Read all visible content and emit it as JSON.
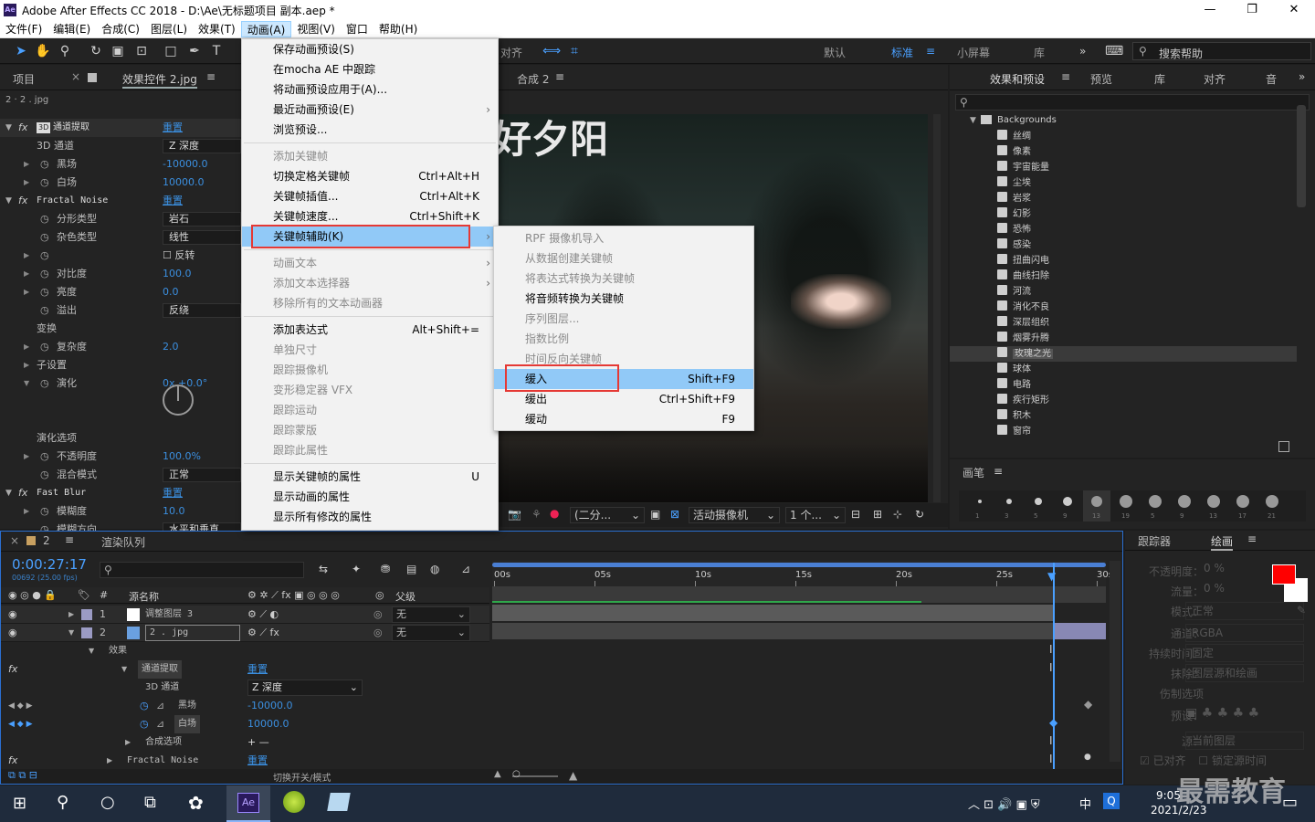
{
  "title": {
    "text": "Adobe After Effects CC 2018 - D:\\Ae\\无标题项目 副本.aep *",
    "logo": "Ae"
  },
  "menubar": [
    "文件(F)",
    "编辑(E)",
    "合成(C)",
    "图层(L)",
    "效果(T)",
    "动画(A)",
    "视图(V)",
    "窗口",
    "帮助(H)"
  ],
  "toolbar": {
    "workspaces": [
      "默认",
      "标准",
      "小屏幕",
      "库"
    ],
    "align_label": "对齐",
    "search_placeholder": "搜索帮助"
  },
  "left_panel": {
    "tabs": [
      "项目",
      "效果控件 2.jpg"
    ],
    "breadcrumb": "2 · 2 . jpg",
    "effects": [
      {
        "name": "通道提取",
        "badge": "3D",
        "reset": "重置"
      },
      {
        "name": "Fractal Noise",
        "reset": "重置"
      },
      {
        "name": "Fast Blur",
        "reset": "重置"
      }
    ],
    "props": [
      {
        "name": "3D 通道",
        "value": "Z 深度",
        "type": "box"
      },
      {
        "name": "黑场",
        "value": "-10000.0"
      },
      {
        "name": "白场",
        "value": "10000.0"
      },
      {
        "name": "分形类型",
        "value": "岩石",
        "type": "box"
      },
      {
        "name": "杂色类型",
        "value": "线性",
        "type": "box"
      },
      {
        "name": "",
        "value": "反转",
        "type": "check"
      },
      {
        "name": "对比度",
        "value": "100.0"
      },
      {
        "name": "亮度",
        "value": "0.0"
      },
      {
        "name": "溢出",
        "value": "反绕",
        "type": "box"
      },
      {
        "name": "变换",
        "value": ""
      },
      {
        "name": "复杂度",
        "value": "2.0"
      },
      {
        "name": "子设置",
        "value": ""
      },
      {
        "name": "演化",
        "value": "0x +0.0°"
      },
      {
        "name": "演化选项",
        "value": ""
      },
      {
        "name": "不透明度",
        "value": "100.0%"
      },
      {
        "name": "混合模式",
        "value": "正常",
        "type": "box"
      },
      {
        "name": "模糊度",
        "value": "10.0"
      },
      {
        "name": "模糊方向",
        "value": "水平和垂直",
        "type": "box"
      }
    ]
  },
  "anim_menu": {
    "items": [
      {
        "label": "保存动画预设(S)",
        "dis": false
      },
      {
        "label": "在mocha AE 中跟踪",
        "dis": false
      },
      {
        "label": "将动画预设应用于(A)...",
        "dis": false
      },
      {
        "label": "最近动画预设(E)",
        "dis": false,
        "arrow": true
      },
      {
        "label": "浏览预设...",
        "dis": false
      },
      {
        "sep": true
      },
      {
        "label": "添加关键帧",
        "dis": true
      },
      {
        "label": "切换定格关键帧",
        "sc": "Ctrl+Alt+H",
        "dis": false
      },
      {
        "label": "关键帧插值...",
        "sc": "Ctrl+Alt+K",
        "dis": false
      },
      {
        "label": "关键帧速度...",
        "sc": "Ctrl+Shift+K",
        "dis": false
      },
      {
        "label": "关键帧辅助(K)",
        "dis": false,
        "arrow": true,
        "hl": true
      },
      {
        "sep": true
      },
      {
        "label": "动画文本",
        "dis": true,
        "arrow": true
      },
      {
        "label": "添加文本选择器",
        "dis": true,
        "arrow": true
      },
      {
        "label": "移除所有的文本动画器",
        "dis": true
      },
      {
        "sep": true
      },
      {
        "label": "添加表达式",
        "sc": "Alt+Shift+=",
        "dis": false
      },
      {
        "label": "单独尺寸",
        "dis": true
      },
      {
        "label": "跟踪摄像机",
        "dis": true
      },
      {
        "label": "变形稳定器 VFX",
        "dis": true
      },
      {
        "label": "跟踪运动",
        "dis": true
      },
      {
        "label": "跟踪蒙版",
        "dis": true
      },
      {
        "label": "跟踪此属性",
        "dis": true
      },
      {
        "sep": true
      },
      {
        "label": "显示关键帧的属性",
        "sc": "U",
        "dis": false
      },
      {
        "label": "显示动画的属性",
        "dis": false
      },
      {
        "label": "显示所有修改的属性",
        "dis": false
      }
    ],
    "submenu": [
      {
        "label": "RPF 摄像机导入",
        "dis": true
      },
      {
        "label": "从数据创建关键帧",
        "dis": true
      },
      {
        "label": "将表达式转换为关键帧",
        "dis": true
      },
      {
        "label": "将音频转换为关键帧",
        "dis": false
      },
      {
        "label": "序列图层...",
        "dis": true
      },
      {
        "label": "指数比例",
        "dis": true
      },
      {
        "label": "时间反向关键帧",
        "dis": true
      },
      {
        "label": "缓入",
        "sc": "Shift+F9",
        "dis": false,
        "hl": true
      },
      {
        "label": "缓出",
        "sc": "Ctrl+Shift+F9",
        "dis": false
      },
      {
        "label": "缓动",
        "sc": "F9",
        "dis": false
      }
    ]
  },
  "comp": {
    "tab": "合成 2",
    "overlay_text": "好夕阳",
    "footer": {
      "res": "(二分...",
      "camera": "活动摄像机",
      "views": "1 个..."
    }
  },
  "effects_presets": {
    "tabs": [
      "效果和预设",
      "预览",
      "库",
      "对齐",
      "音"
    ],
    "folder": "Backgrounds",
    "items": [
      "丝绸",
      "像素",
      "宇宙能量",
      "尘埃",
      "岩浆",
      "幻影",
      "恐怖",
      "感染",
      "扭曲闪电",
      "曲线扫除",
      "河流",
      "消化不良",
      "深层组织",
      "烟雾升腾",
      "玫瑰之光",
      "球体",
      "电路",
      "疾行矩形",
      "积木",
      "窗帘"
    ],
    "selected": "玫瑰之光"
  },
  "brushes": {
    "title": "画笔",
    "sizes": [
      "1",
      "3",
      "5",
      "9",
      "13",
      "19",
      "5",
      "9",
      "13",
      "17",
      "21"
    ]
  },
  "timeline": {
    "tabs": [
      "2",
      "渲染队列"
    ],
    "timecode": "0:00:27:17",
    "fps": "00692 (25.00 fps)",
    "cols": {
      "name": "源名称",
      "parent": "父级"
    },
    "ruler": [
      "00s",
      "05s",
      "10s",
      "15s",
      "20s",
      "25s",
      "30s"
    ],
    "layers": [
      {
        "num": "1",
        "name": "调整图层 3",
        "parent": "无"
      },
      {
        "num": "2",
        "name": "2 . jpg",
        "parent": "无"
      }
    ],
    "sub": [
      {
        "label": "效果"
      },
      {
        "label": "通道提取",
        "reset": "重置"
      },
      {
        "label": "3D 通道",
        "value": "Z 深度"
      },
      {
        "label": "黑场",
        "value": "-10000.0"
      },
      {
        "label": "白场",
        "value": "10000.0"
      },
      {
        "label": "合成选项",
        "value": "+ —"
      },
      {
        "label": "Fractal Noise",
        "reset": "重置"
      }
    ],
    "footer": "切换开关/模式"
  },
  "paint": {
    "tabs": [
      "跟踪器",
      "绘画"
    ],
    "rows": [
      {
        "l": "不透明度：",
        "v": "0 %"
      },
      {
        "l": "流量：",
        "v": "0 %"
      },
      {
        "l": "模式：",
        "v": "正常"
      },
      {
        "l": "通道：",
        "v": "RGBA"
      },
      {
        "l": "持续时间：",
        "v": "固定"
      },
      {
        "l": "抹除：",
        "v": "图层源和绘画"
      },
      {
        "l": "伤制选项",
        "v": ""
      },
      {
        "l": "预设：",
        "v": ""
      },
      {
        "l": "源：",
        "v": "当前图层"
      }
    ],
    "checks": [
      "已对齐",
      "锁定源时间"
    ],
    "color_fg": "#ff0000",
    "color_bg": "#ffffff"
  },
  "taskbar": {
    "time": "9:05",
    "date": "2021/2/23",
    "ime": "中",
    "watermark": "最需教育"
  }
}
